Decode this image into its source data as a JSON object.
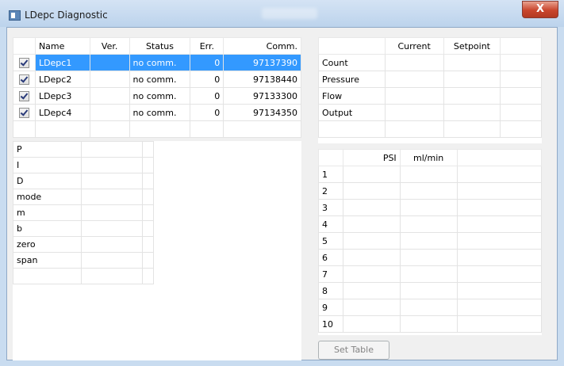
{
  "window": {
    "title": "LDepc Diagnostic",
    "close_label": "X"
  },
  "devices": {
    "columns": [
      "Name",
      "Ver.",
      "Status",
      "Err.",
      "Comm."
    ],
    "rows": [
      {
        "name": "LDepc1",
        "ver": "",
        "status": "no comm.",
        "err": "0",
        "comm": "97137390",
        "checked": true,
        "selected": true
      },
      {
        "name": "LDepc2",
        "ver": "",
        "status": "no comm.",
        "err": "0",
        "comm": "97138440",
        "checked": true,
        "selected": false
      },
      {
        "name": "LDepc3",
        "ver": "",
        "status": "no comm.",
        "err": "0",
        "comm": "97133300",
        "checked": true,
        "selected": false
      },
      {
        "name": "LDepc4",
        "ver": "",
        "status": "no comm.",
        "err": "0",
        "comm": "97134350",
        "checked": true,
        "selected": false
      }
    ]
  },
  "params": {
    "rows": [
      "P",
      "I",
      "D",
      "mode",
      "m",
      "b",
      "zero",
      "span"
    ]
  },
  "state": {
    "columns": [
      "Current",
      "Setpoint"
    ],
    "rows": [
      "Count",
      "Pressure",
      "Flow",
      "Output"
    ]
  },
  "pressure_table": {
    "columns": [
      "PSI",
      "ml/min"
    ],
    "rows": [
      "1",
      "2",
      "3",
      "4",
      "5",
      "6",
      "7",
      "8",
      "9",
      "10"
    ]
  },
  "buttons": {
    "set_table": "Set Table"
  },
  "colors": {
    "selection": "#3399ff",
    "close": "#c9462d"
  }
}
